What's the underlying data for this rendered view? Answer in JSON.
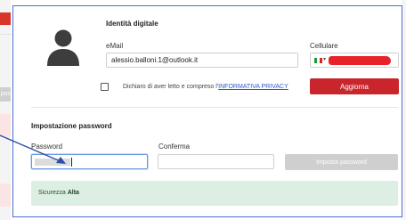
{
  "background": {
    "left_tab_fragment": "pos"
  },
  "identity": {
    "title": "Identità digitale",
    "email_label": "eMail",
    "email_value": "alessio.balloni.1@outlook.it",
    "phone_label": "Cellulare",
    "phone_flag_icon": "flag-italy-icon",
    "phone_value_redacted": true
  },
  "privacy": {
    "text": "Dichiaro di aver letto e compreso l'",
    "link": "INFORMATIVA PRIVACY",
    "checked": false
  },
  "buttons": {
    "update": "Aggiorna",
    "set_password": "Imposta password"
  },
  "password_section": {
    "title": "Impostazione password",
    "password_label": "Password",
    "confirm_label": "Conferma"
  },
  "strength": {
    "label": "Sicurezza",
    "value": "Alta"
  },
  "colors": {
    "accent_red": "#c8262c",
    "focus_border": "#6b9ae0",
    "success_bg": "#dcefe2",
    "link": "#2a59c9"
  }
}
